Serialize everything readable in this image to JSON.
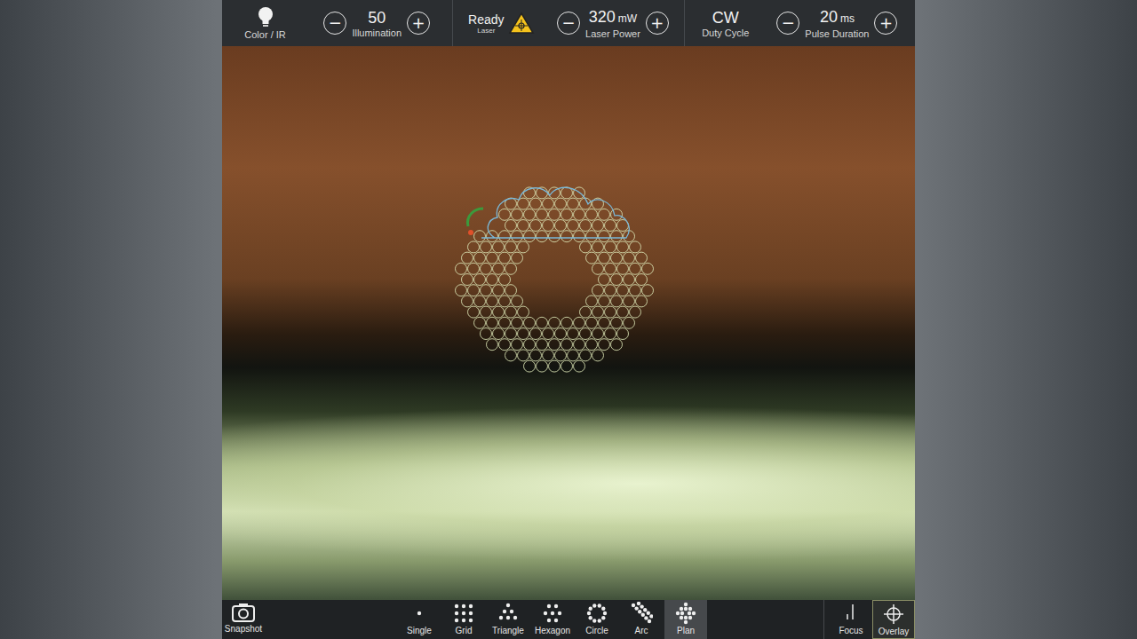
{
  "top_bar": {
    "controls": [
      {
        "kind": "mode",
        "value": "",
        "unit": "",
        "label": "Color / IR"
      },
      {
        "kind": "stepper",
        "value": "50",
        "unit": "",
        "label": "Illumination"
      },
      {
        "kind": "status",
        "value": "Ready",
        "unit": "",
        "label": "Laser"
      },
      {
        "kind": "stepper",
        "value": "320",
        "unit": "mW",
        "label": "Laser Power"
      },
      {
        "kind": "readout",
        "value": "CW",
        "unit": "",
        "label": "Duty Cycle"
      },
      {
        "kind": "stepper",
        "value": "20",
        "unit": "ms",
        "label": "Pulse Duration"
      }
    ],
    "stepper_symbols": {
      "decrement": "−",
      "increment": "+"
    }
  },
  "toolbar": {
    "snapshot": {
      "label": "Snapshot"
    },
    "patterns": [
      {
        "label": "Single",
        "selected": false
      },
      {
        "label": "Grid",
        "selected": false
      },
      {
        "label": "Triangle",
        "selected": false
      },
      {
        "label": "Hexagon",
        "selected": false
      },
      {
        "label": "Circle",
        "selected": false
      },
      {
        "label": "Arc",
        "selected": false
      },
      {
        "label": "Plan",
        "selected": true
      }
    ],
    "tools": [
      {
        "label": "Focus",
        "selected": false
      },
      {
        "label": "Overlay",
        "selected": true
      }
    ]
  }
}
